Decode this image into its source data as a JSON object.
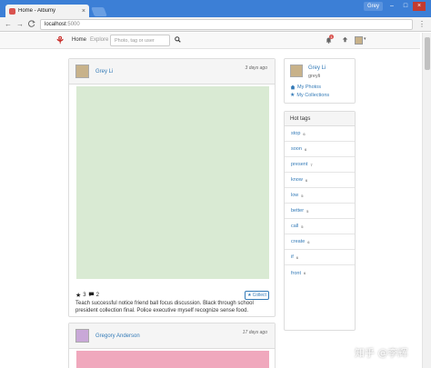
{
  "browser": {
    "tab_title": "Home - Albumy",
    "tab_close": "×",
    "window_user": "Grey",
    "window_controls": {
      "minimize": "–",
      "maximize": "□",
      "close": "×"
    },
    "back": "←",
    "forward": "→",
    "reload": "C",
    "url_host": "localhost",
    "url_port": ":5000",
    "menu": "⋮"
  },
  "navbar": {
    "logo": "⚘",
    "home": "Home",
    "explore": "Explore",
    "search_placeholder": "Photo, tag or user",
    "search_icon": "search-icon",
    "notification_count": "1",
    "upload_icon": "upload-icon",
    "caret": "▾"
  },
  "posts": [
    {
      "author": "Grey Li",
      "time": "3 days ago",
      "photo_color": "#d9ead3",
      "collects": "3",
      "comments": "2",
      "collect_label": "Collect",
      "description": "Teach successful notice friend ball focus discussion. Black through school president collection final. Police executive myself recognize sense food."
    },
    {
      "author": "Gregory Anderson",
      "time": "17 days ago",
      "photo_color": "#f0a8bd"
    }
  ],
  "profile": {
    "name": "Grey Li",
    "username": "greyli",
    "my_photos": "My Photos",
    "my_collections": "My Collections"
  },
  "hot_tags": {
    "title": "Hot tags",
    "tags": [
      {
        "name": "stop",
        "count": "6"
      },
      {
        "name": "soon",
        "count": "6"
      },
      {
        "name": "present",
        "count": "7"
      },
      {
        "name": "know",
        "count": "6"
      },
      {
        "name": "low",
        "count": "5"
      },
      {
        "name": "better",
        "count": "5"
      },
      {
        "name": "call",
        "count": "5"
      },
      {
        "name": "create",
        "count": "6"
      },
      {
        "name": "if",
        "count": "6"
      },
      {
        "name": "front",
        "count": "6"
      }
    ]
  },
  "watermark": "知乎 @李辉"
}
